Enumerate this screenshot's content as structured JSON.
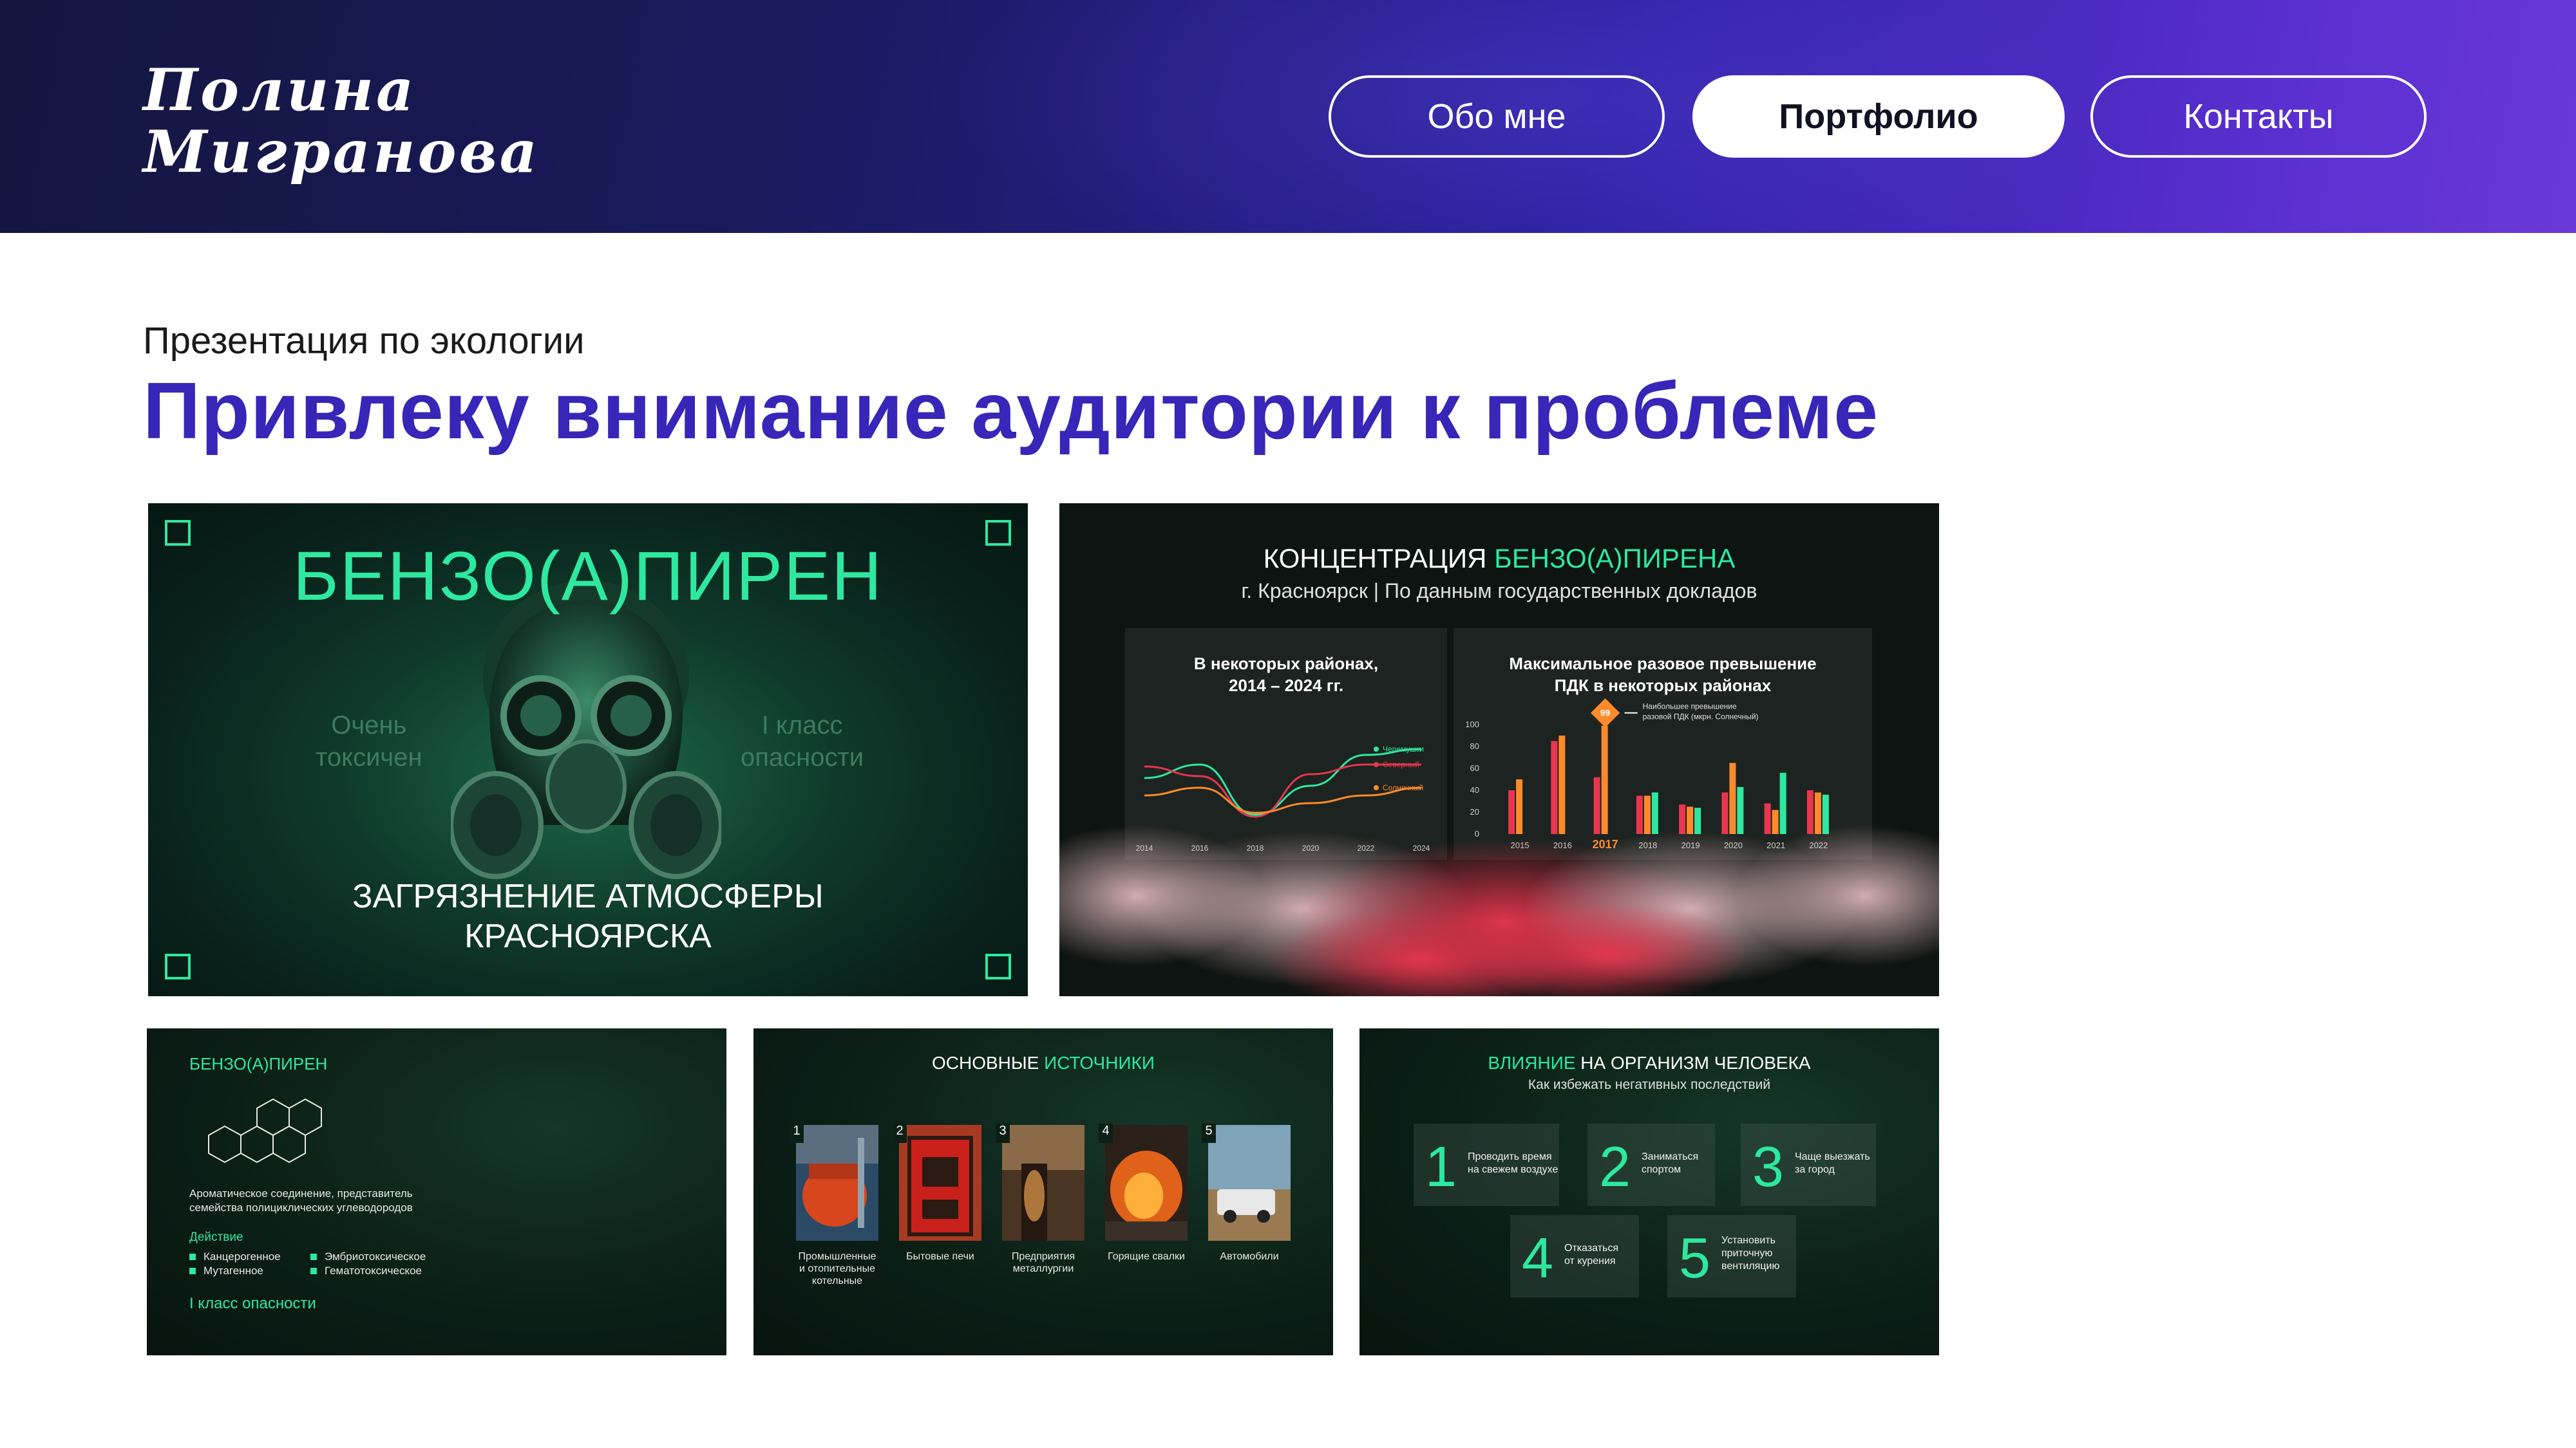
{
  "header": {
    "logo_line1": "Полина",
    "logo_line2": "Мигранова",
    "nav": [
      {
        "label": "Обо мне",
        "active": false
      },
      {
        "label": "Портфолио",
        "active": true
      },
      {
        "label": "Контакты",
        "active": false
      }
    ]
  },
  "section": {
    "subtitle": "Презентация по экологии",
    "title": "Привлеку внимание аудитории к проблеме"
  },
  "slide1": {
    "title": "БЕНЗО(А)ПИРЕН",
    "left_note": [
      "Очень",
      "токсичен"
    ],
    "right_note": [
      "I класс",
      "опасности"
    ],
    "bottom": [
      "ЗАГРЯЗНЕНИЕ АТМОСФЕРЫ",
      "КРАСНОЯРСКА"
    ]
  },
  "slide2": {
    "title_main": "КОНЦЕНТРАЦИЯ ",
    "title_accent": "БЕНЗО(А)ПИРЕНА",
    "subtitle": "г. Красноярск | По данным государственных докладов",
    "panel_left": {
      "title": [
        "В некоторых районах,",
        "2014 – 2024 гг."
      ],
      "x_ticks": [
        "2014",
        "2016",
        "2018",
        "2020",
        "2022",
        "2024"
      ],
      "legend": [
        "Черемушки",
        "Северный",
        "Солнечный"
      ]
    },
    "panel_right": {
      "title": [
        "Максимальное разовое превышение",
        "ПДК в некоторых районах"
      ],
      "y_ticks": [
        "100",
        "80",
        "60",
        "40",
        "20",
        "0"
      ],
      "x_ticks": [
        "2015",
        "2016",
        "2017",
        "2018",
        "2019",
        "2020",
        "2021",
        "2022"
      ],
      "marker": "99",
      "note": [
        "Наибольшее превышение",
        "разовой ПДК (мкрн. Солнечный)"
      ]
    },
    "colors": {
      "red": "#e8364e",
      "orange": "#ff8a2a",
      "green": "#2ee8a0"
    }
  },
  "chart_data": [
    {
      "type": "bar",
      "title": "Максимальное разовое превышение ПДК в некоторых районах",
      "categories": [
        "2015",
        "2016",
        "2017",
        "2018",
        "2019",
        "2020",
        "2021",
        "2022"
      ],
      "series": [
        {
          "values": [
            40,
            85,
            52,
            35,
            27,
            38,
            28,
            40
          ]
        },
        {
          "values": [
            50,
            90,
            99,
            35,
            25,
            65,
            22,
            38
          ]
        },
        {
          "values": [
            0,
            0,
            0,
            38,
            24,
            43,
            56,
            36
          ]
        }
      ],
      "ylim": [
        0,
        100
      ]
    },
    {
      "type": "line",
      "title": "В некоторых районах, 2014 – 2024 гг.",
      "x": [
        2014,
        2016,
        2018,
        2020,
        2022,
        2024
      ],
      "series": [
        {
          "name": "Черемушки",
          "values": [
            58,
            72,
            20,
            50,
            82,
            88
          ]
        },
        {
          "name": "Северный",
          "values": [
            70,
            60,
            18,
            62,
            72,
            72
          ]
        },
        {
          "name": "Солнечный",
          "values": [
            40,
            48,
            22,
            32,
            40,
            48
          ]
        }
      ]
    }
  ],
  "slide3": {
    "head": "БЕНЗО(А)ПИРЕН",
    "desc": [
      "Ароматическое соединение, представитель",
      "семейства полициклических углеводородов"
    ],
    "action_label": "Действие",
    "effects_left": [
      "Канцерогенное",
      "Мутагенное"
    ],
    "effects_right": [
      "Эмбриотоксическое",
      "Гематотоксическое"
    ],
    "danger": "I класс опасности"
  },
  "slide4": {
    "head_main": "ОСНОВНЫЕ ",
    "head_accent": "ИСТОЧНИКИ",
    "sources": [
      {
        "num": "1",
        "label": "Промышленные и отопительные котельные"
      },
      {
        "num": "2",
        "label": "Бытовые печи"
      },
      {
        "num": "3",
        "label": "Предприятия металлургии"
      },
      {
        "num": "4",
        "label": "Горящие свалки"
      },
      {
        "num": "5",
        "label": "Автомобили"
      }
    ]
  },
  "slide5": {
    "head_accent": "ВЛИЯНИЕ",
    "head_main": " НА ОРГАНИЗМ ЧЕЛОВЕКА",
    "subtitle": "Как избежать негативных последствий",
    "tips": [
      {
        "num": "1",
        "text": [
          "Проводить время",
          "на свежем воздухе"
        ]
      },
      {
        "num": "2",
        "text": [
          "Заниматься",
          "спортом"
        ]
      },
      {
        "num": "3",
        "text": [
          "Чаще выезжать",
          "за город"
        ]
      },
      {
        "num": "4",
        "text": [
          "Отказаться",
          "от курения"
        ]
      },
      {
        "num": "5",
        "text": [
          "Установить",
          "приточную",
          "вентиляцию"
        ]
      }
    ]
  }
}
